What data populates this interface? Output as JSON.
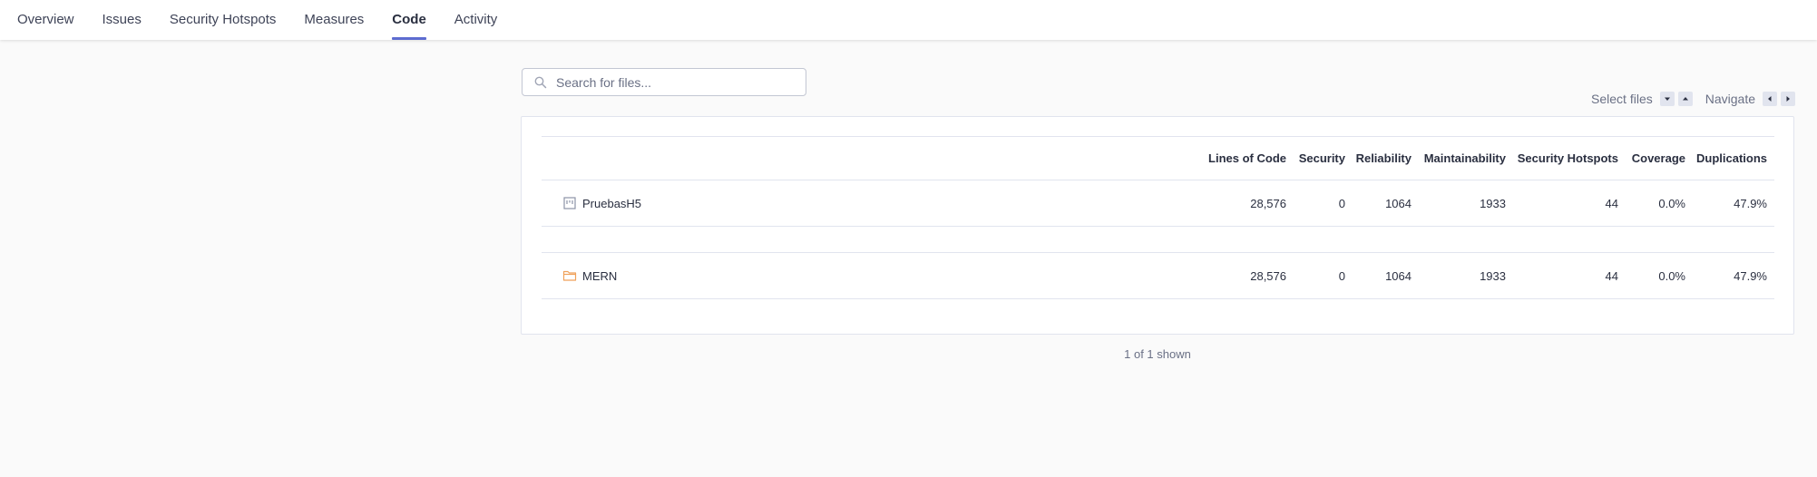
{
  "tabs": [
    {
      "label": "Overview",
      "active": false
    },
    {
      "label": "Issues",
      "active": false
    },
    {
      "label": "Security Hotspots",
      "active": false
    },
    {
      "label": "Measures",
      "active": false
    },
    {
      "label": "Code",
      "active": true
    },
    {
      "label": "Activity",
      "active": false
    }
  ],
  "search": {
    "placeholder": "Search for files...",
    "value": ""
  },
  "shortcuts": {
    "select_label": "Select files",
    "navigate_label": "Navigate"
  },
  "table": {
    "columns": [
      "Lines of Code",
      "Security",
      "Reliability",
      "Maintainability",
      "Security Hotspots",
      "Coverage",
      "Duplications"
    ],
    "base_row": {
      "name": "PruebasH5",
      "icon": "project-icon",
      "values": [
        "28,576",
        "0",
        "1064",
        "1933",
        "44",
        "0.0%",
        "47.9%"
      ]
    },
    "rows": [
      {
        "name": "MERN",
        "icon": "folder-icon",
        "values": [
          "28,576",
          "0",
          "1064",
          "1933",
          "44",
          "0.0%",
          "47.9%"
        ]
      }
    ]
  },
  "footer": {
    "count_text": "1 of 1 shown"
  },
  "colors": {
    "accent": "#5d6cd0",
    "folder": "#f0a15a",
    "border": "#e1e4ee"
  }
}
